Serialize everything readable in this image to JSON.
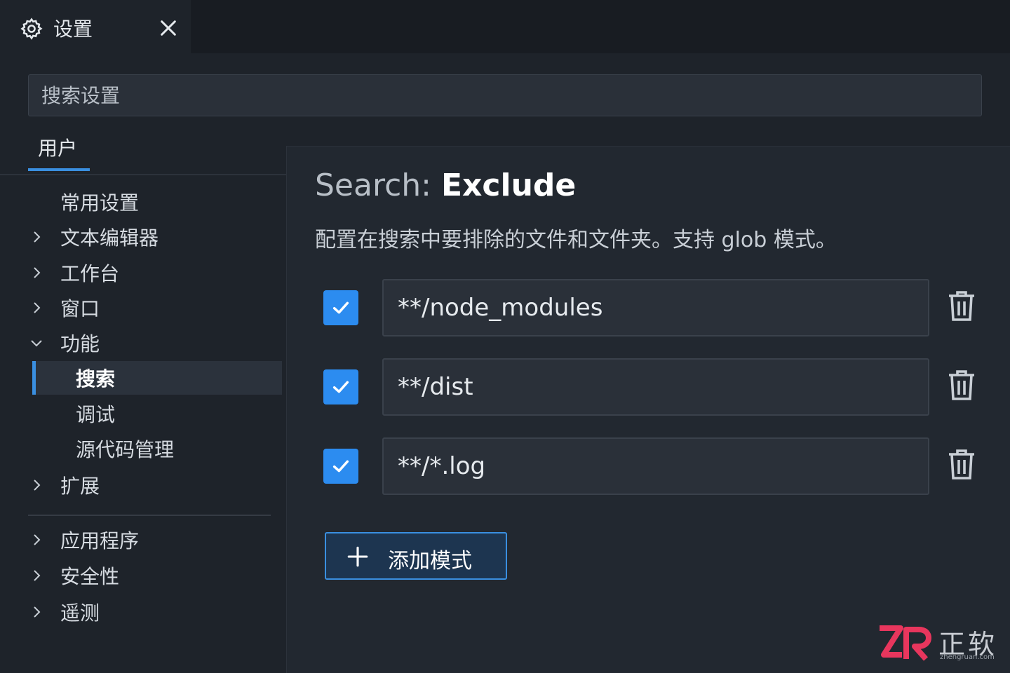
{
  "tab": {
    "title": "设置",
    "icon": "gear-icon",
    "close_icon": "close-icon"
  },
  "search": {
    "placeholder": "搜索设置",
    "value": ""
  },
  "scope_tabs": [
    {
      "label": "用户",
      "active": true
    }
  ],
  "sidebar": {
    "items": [
      {
        "label": "常用设置",
        "chevron": "none"
      },
      {
        "label": "文本编辑器",
        "chevron": "right"
      },
      {
        "label": "工作台",
        "chevron": "right"
      },
      {
        "label": "窗口",
        "chevron": "right"
      },
      {
        "label": "功能",
        "chevron": "down"
      },
      {
        "label": "搜索",
        "chevron": "none",
        "selected": true
      },
      {
        "label": "调试",
        "chevron": "none"
      },
      {
        "label": "源代码管理",
        "chevron": "none"
      },
      {
        "label": "扩展",
        "chevron": "right"
      },
      {
        "label": "应用程序",
        "chevron": "right"
      },
      {
        "label": "安全性",
        "chevron": "right"
      },
      {
        "label": "遥测",
        "chevron": "right"
      }
    ]
  },
  "setting": {
    "category": "Search: ",
    "name": "Exclude",
    "description": "配置在搜索中要排除的文件和文件夹。支持 glob 模式。",
    "patterns": [
      {
        "value": "**/node_modules",
        "checked": true
      },
      {
        "value": "**/dist",
        "checked": true
      },
      {
        "value": "**/*.log",
        "checked": true
      }
    ],
    "add_label": "添加模式"
  },
  "watermark": {
    "brand": "正软",
    "url": "zhengruan.com"
  },
  "colors": {
    "accent": "#3a8fe0",
    "checkbox": "#2c8cf0",
    "background": "#1e232a",
    "panel": "#222830"
  }
}
